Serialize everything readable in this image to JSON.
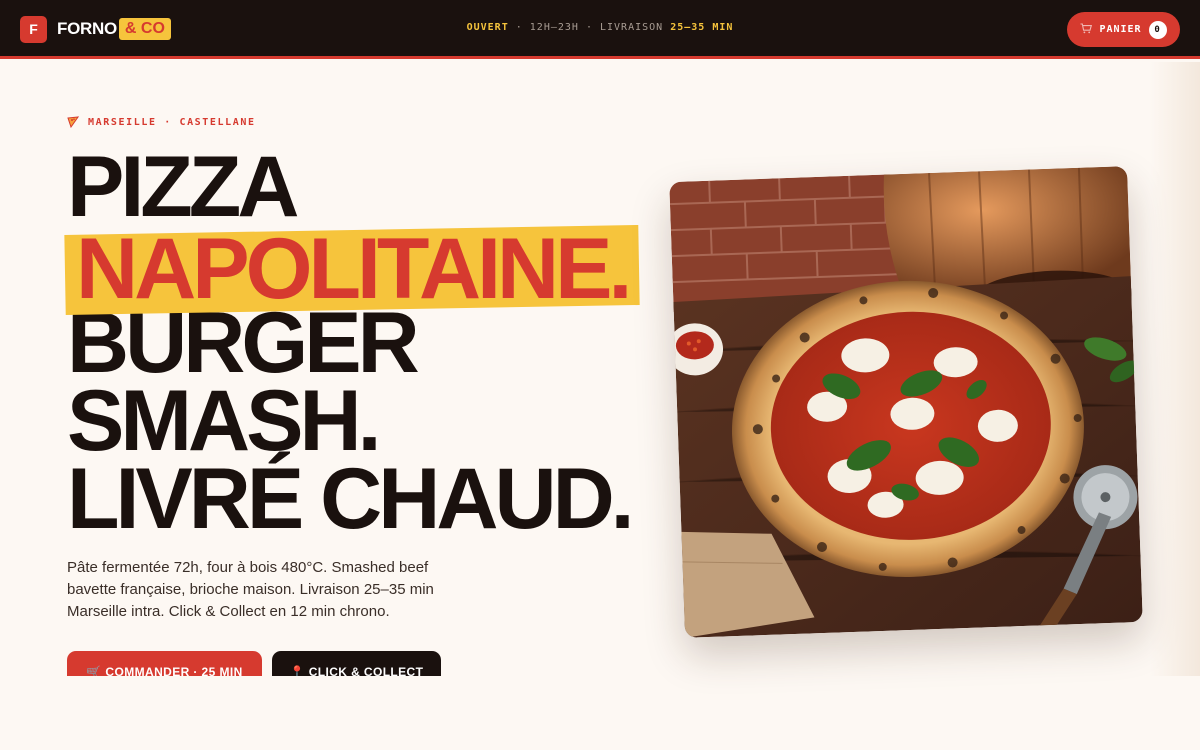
{
  "brand": {
    "mark": "F",
    "name": "FORNO",
    "tag": "& CO"
  },
  "header": {
    "status_open": "OUVERT",
    "status_hours": "· 12H–23H · LIVRAISON",
    "status_delivery": "25–35 MIN",
    "cart_label": "PANIER",
    "cart_count": "0"
  },
  "hero": {
    "eyebrow": "MARSEILLE · CASTELLANE",
    "line1": "PIZZA",
    "line2": "NAPOLITAINE.",
    "line3": "BURGER",
    "line4": "SMASH.",
    "line5": "LIVRÉ CHAUD.",
    "lead": "Pâte fermentée 72h, four à bois 480°C. Smashed beef bavette française, brioche maison. Livraison 25–35 min Marseille intra. Click & Collect en 12 min chrono.",
    "cta_primary": "🛒 COMMANDER · 25 MIN",
    "cta_secondary": "📍 CLICK & COLLECT"
  },
  "icons": {
    "brand_logo": "logo-mark",
    "cart": "cart-icon",
    "eyebrow": "pizza-slice-icon"
  },
  "colors": {
    "brand_red": "#d63a2f",
    "brand_yellow": "#f6c43c",
    "ink": "#1a110e",
    "background": "#fdf8f3"
  }
}
